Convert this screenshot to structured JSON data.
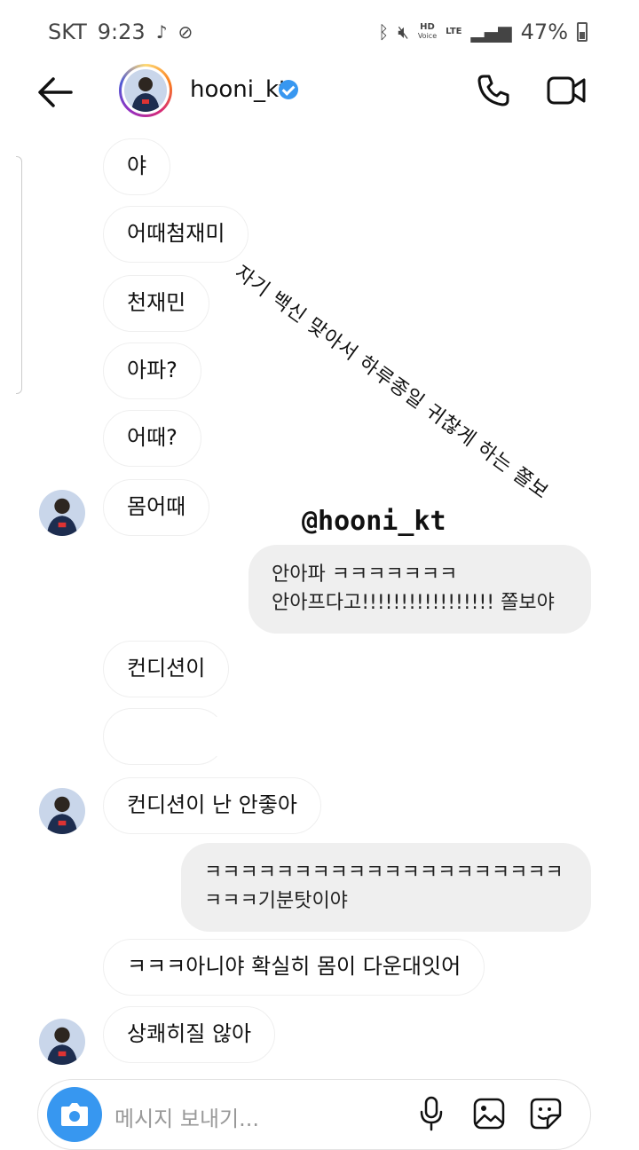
{
  "status_bar": {
    "carrier": "SKT",
    "time": "9:23",
    "hd_label": "HD",
    "voice_label": "Voice",
    "lte_label": "LTE",
    "battery": "47%"
  },
  "header": {
    "username": "hooni_kt",
    "verified": true
  },
  "overlay": {
    "diagonal_text": "자기 백신 맞아서 하루종일 귀찮게 하는 쫄보",
    "mention": "@hooni_kt"
  },
  "messages": [
    {
      "from": "them",
      "text": "야"
    },
    {
      "from": "them",
      "text": "어때첨재미"
    },
    {
      "from": "them",
      "text": "천재민"
    },
    {
      "from": "them",
      "text": "아파?"
    },
    {
      "from": "them",
      "text": "어때?"
    },
    {
      "from": "them",
      "text": "몸어때"
    },
    {
      "from": "me",
      "lines": [
        "안아파 ㅋㅋㅋㅋㅋㅋㅋ",
        "안아프다고!!!!!!!!!!!!!!!!! 쫄보야"
      ]
    },
    {
      "from": "them",
      "text": "컨디션이"
    },
    {
      "from": "them",
      "text": ""
    },
    {
      "from": "them",
      "text": "컨디션이 난 안좋아"
    },
    {
      "from": "me",
      "lines": [
        "ㅋㅋㅋㅋㅋㅋㅋㅋㅋㅋㅋㅋㅋㅋㅋㅋㅋㅋㅋㅋ",
        "ㅋㅋㅋ기분탓이야"
      ]
    },
    {
      "from": "them",
      "text": "ㅋㅋㅋ아니야 확실히 몸이 다운대잇어"
    },
    {
      "from": "them",
      "text": "상쾌히질 않아"
    }
  ],
  "composer": {
    "placeholder": "메시지 보내기..."
  },
  "colors": {
    "accent": "#3797f0",
    "bubble_out": "#efefef",
    "verified": "#3897f0"
  }
}
